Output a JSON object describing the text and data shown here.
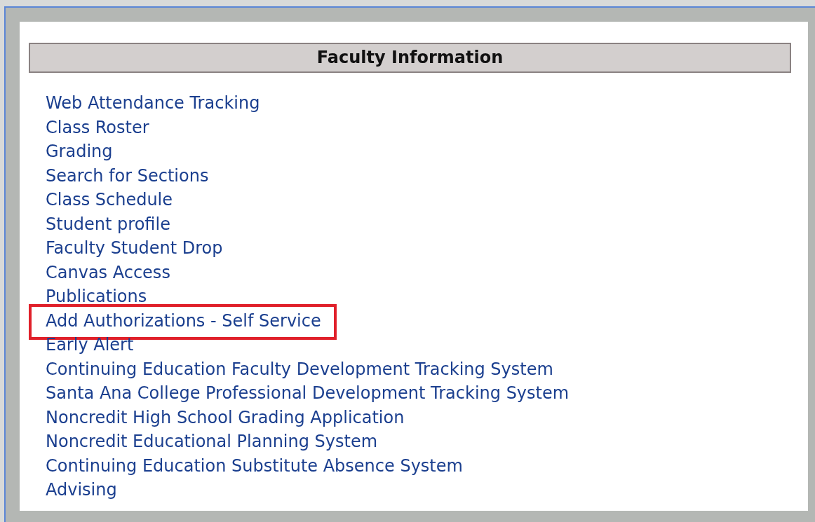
{
  "panel": {
    "title": "Faculty Information"
  },
  "links": [
    {
      "label": "Web Attendance Tracking",
      "highlighted": false
    },
    {
      "label": "Class Roster",
      "highlighted": false
    },
    {
      "label": "Grading",
      "highlighted": false
    },
    {
      "label": "Search for Sections",
      "highlighted": false
    },
    {
      "label": "Class Schedule",
      "highlighted": false
    },
    {
      "label": "Student profile",
      "highlighted": false
    },
    {
      "label": "Faculty Student Drop",
      "highlighted": false
    },
    {
      "label": "Canvas Access",
      "highlighted": false
    },
    {
      "label": "Publications",
      "highlighted": false
    },
    {
      "label": "Add Authorizations - Self Service",
      "highlighted": true
    },
    {
      "label": "Early Alert",
      "highlighted": false
    },
    {
      "label": "Continuing Education Faculty Development Tracking System",
      "highlighted": false
    },
    {
      "label": "Santa Ana College Professional Development Tracking System",
      "highlighted": false
    },
    {
      "label": "Noncredit High School Grading Application",
      "highlighted": false
    },
    {
      "label": "Noncredit Educational Planning System",
      "highlighted": false
    },
    {
      "label": "Continuing Education Substitute Absence System",
      "highlighted": false
    },
    {
      "label": "Advising",
      "highlighted": false
    }
  ]
}
